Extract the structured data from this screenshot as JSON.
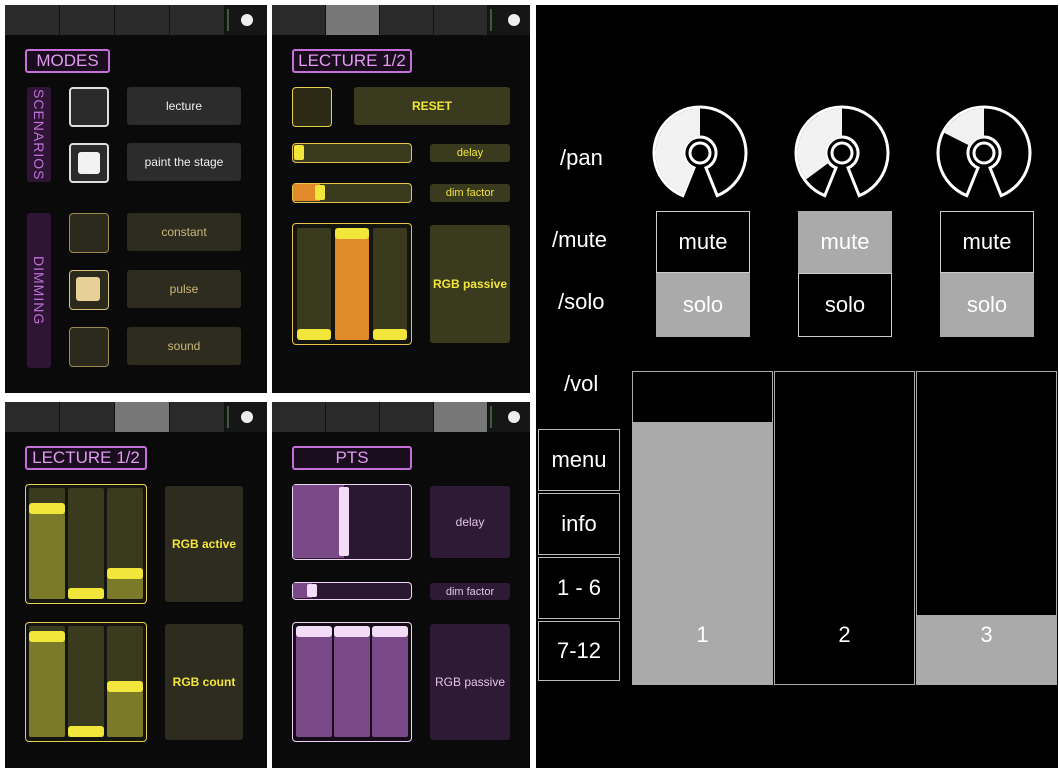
{
  "colors": {
    "purple": "#c66fd8",
    "yellow": "#f2e63a",
    "orange": "#e08a2a",
    "olive": "#3a3a1e",
    "lavender": "#efd6f5",
    "osc_gray": "#aaaaaa"
  },
  "panel1": {
    "tabs": [
      {
        "active": true
      },
      {
        "active": false
      },
      {
        "active": false
      },
      {
        "active": false
      }
    ],
    "title": "MODES",
    "scenarios_label": "SCENARIOS",
    "dimming_label": "DIMMING",
    "scenarios": [
      {
        "label": "lecture",
        "checked": false
      },
      {
        "label": "paint the stage",
        "checked": true
      }
    ],
    "dimming": [
      {
        "label": "constant",
        "checked": false
      },
      {
        "label": "pulse",
        "checked": true
      },
      {
        "label": "sound",
        "checked": false
      }
    ]
  },
  "panel2": {
    "tabs": [
      {
        "active": false
      },
      {
        "active": true
      },
      {
        "active": false
      },
      {
        "active": false
      }
    ],
    "title": "LECTURE 1/2",
    "reset_label": "RESET",
    "delay_label": "delay",
    "delay_value": 0.0,
    "dim_label": "dim factor",
    "dim_value": 0.2,
    "rgb_label": "RGB passive",
    "rgb_values": [
      0.0,
      1.0,
      0.0
    ]
  },
  "panel3": {
    "tabs": [
      {
        "active": false
      },
      {
        "active": false
      },
      {
        "active": true
      },
      {
        "active": false
      }
    ],
    "title": "LECTURE 1/2",
    "rgb_active_label": "RGB active",
    "rgb_active_values": [
      0.85,
      0.0,
      0.2
    ],
    "rgb_count_label": "RGB count",
    "rgb_count_values": [
      0.95,
      0.0,
      0.45
    ]
  },
  "panel4": {
    "tabs": [
      {
        "active": false
      },
      {
        "active": false
      },
      {
        "active": false
      },
      {
        "active": true
      }
    ],
    "title": "PTS",
    "delay_label": "delay",
    "delay_value": 0.42,
    "dim_label": "dim factor",
    "dim_value": 0.12,
    "rgb_label": "RGB passive",
    "rgb_values": [
      1.0,
      1.0,
      1.0
    ]
  },
  "osc": {
    "pan_label": "/pan",
    "mute_label": "/mute",
    "solo_label": "/solo",
    "vol_label": "/vol",
    "mute_text": "mute",
    "solo_text": "solo",
    "channels": [
      {
        "number": "1",
        "pan": 0.5,
        "mute": false,
        "solo": true,
        "vol": 0.84
      },
      {
        "number": "2",
        "pan": 0.1,
        "mute": true,
        "solo": false,
        "vol": 0.0
      },
      {
        "number": "3",
        "pan": 0.3,
        "mute": false,
        "solo": true,
        "vol": 0.22
      }
    ],
    "menu": [
      "menu",
      "info",
      "1 - 6",
      "7-12"
    ]
  }
}
